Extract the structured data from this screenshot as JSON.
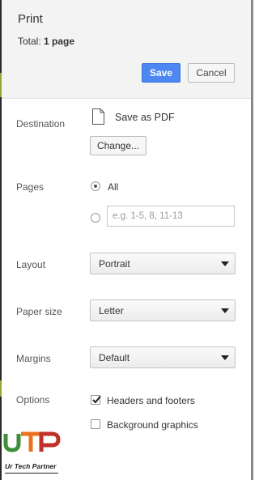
{
  "header": {
    "title": "Print",
    "total_prefix": "Total:",
    "total_value": "1 page",
    "save_label": "Save",
    "cancel_label": "Cancel"
  },
  "destination": {
    "label": "Destination",
    "name": "Save as PDF",
    "change_label": "Change..."
  },
  "pages": {
    "label": "Pages",
    "all_label": "All",
    "all_selected": true,
    "custom_placeholder": "e.g. 1-5, 8, 11-13"
  },
  "layout": {
    "label": "Layout",
    "value": "Portrait"
  },
  "paper_size": {
    "label": "Paper size",
    "value": "Letter"
  },
  "margins": {
    "label": "Margins",
    "value": "Default"
  },
  "options": {
    "label": "Options",
    "headers_footers_label": "Headers and footers",
    "headers_footers_checked": true,
    "background_graphics_label": "Background graphics",
    "background_graphics_checked": false
  },
  "watermark": {
    "text": "Ur Tech Partner"
  },
  "colors": {
    "accent": "#4c87f2",
    "logo_green": "#3f8f3a",
    "logo_orange": "#e8731c",
    "logo_red": "#c0312b"
  }
}
